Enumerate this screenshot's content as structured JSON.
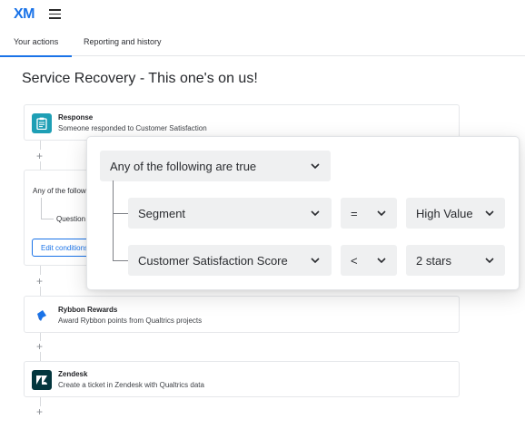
{
  "app": {
    "logo": "XM"
  },
  "tabs": [
    {
      "label": "Your actions",
      "active": true
    },
    {
      "label": "Reporting and history",
      "active": false
    }
  ],
  "page": {
    "title": "Service Recovery - This one's on us!"
  },
  "workflow": {
    "response": {
      "title": "Response",
      "subtitle": "Someone responded to Customer Satisfaction",
      "icon": "clipboard-icon",
      "icon_color": "#1e9fb5"
    },
    "condition": {
      "text": "Any of the following are true",
      "sub": "Question",
      "edit_label": "Edit conditions"
    },
    "rybbon": {
      "title": "Rybbon Rewards",
      "subtitle": "Award Rybbon points from Qualtrics projects",
      "icon": "rybbon-icon",
      "icon_color": "#1a73e8"
    },
    "zendesk": {
      "title": "Zendesk",
      "subtitle": "Create a ticket in Zendesk with Qualtrics data",
      "icon": "zendesk-icon",
      "icon_color": "#03363d"
    }
  },
  "popover": {
    "logic": "Any of the following are true",
    "rows": [
      {
        "field": "Segment",
        "operator": "=",
        "value": "High Value"
      },
      {
        "field": "Customer Satisfaction Score",
        "operator": "<",
        "value": "2 stars"
      }
    ]
  },
  "colors": {
    "accent": "#1a73e8",
    "border": "#e5e7ea",
    "dropdown_bg": "#eff0f1"
  }
}
